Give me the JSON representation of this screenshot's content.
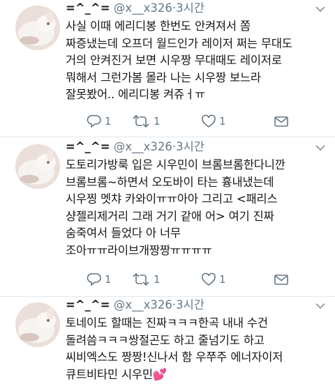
{
  "tweets": [
    {
      "author_name": "=^_^=",
      "handle": "@x__x326",
      "separator": "·",
      "time": "3시간",
      "text": "사실 이때 에리디봉 한번도 안켜져서 쫌\n짜증냈는데 오프더 월드인가 레이저 쩌는 무대도\n거의 안켜진거 보면 시우짱 무대때도 레이저로\n뭐해서 그런가봄 몰라 나는 시우짱 보느라\n잘못봤어.. 에리디봉 켜쥬ㅓㅠ",
      "reply_count": "1",
      "retweet_count": "1",
      "like_count": "1"
    },
    {
      "author_name": "=^_^=",
      "handle": "@x__x326",
      "separator": "·",
      "time": "3시간",
      "text": "도토리가방룩 입은 시우민이 브롬브롬한다니깐\n브롬브롬~하면서 오도바이 타는 흉내냈는데\n시우찡 멧챠 카와이ㅠㅠ아아 그리고 <패리스\n샹젤리제거리 그래 거기 같애 어> 여기 진짜\n숨죽여서 들었다 아 너무\n조아ㅠㅠ라이브개짱짱ㅠㅠㅠㅠ",
      "reply_count": "1",
      "retweet_count": "1",
      "like_count": "1"
    },
    {
      "author_name": "=^_^=",
      "handle": "@x__x326",
      "separator": "·",
      "time": "3시간",
      "text": "토네이도 할때는 진짜ㅋㅋㅋ한곡 내내 수건\n돌려씀ㅋㅋㅋ쌍절곤도 하고 줄넘기도 하고\n씨비엑스도 짱짱!신나서 함 우쭈주 에너자이저\n큐트비타민 시우민💕"
    }
  ],
  "colors": {
    "text": "#14171a",
    "secondary": "#657786",
    "divider": "#e1e8ed"
  },
  "icons": [
    "avatar-image",
    "chevron-down-icon",
    "reply-icon",
    "retweet-icon",
    "like-icon"
  ]
}
